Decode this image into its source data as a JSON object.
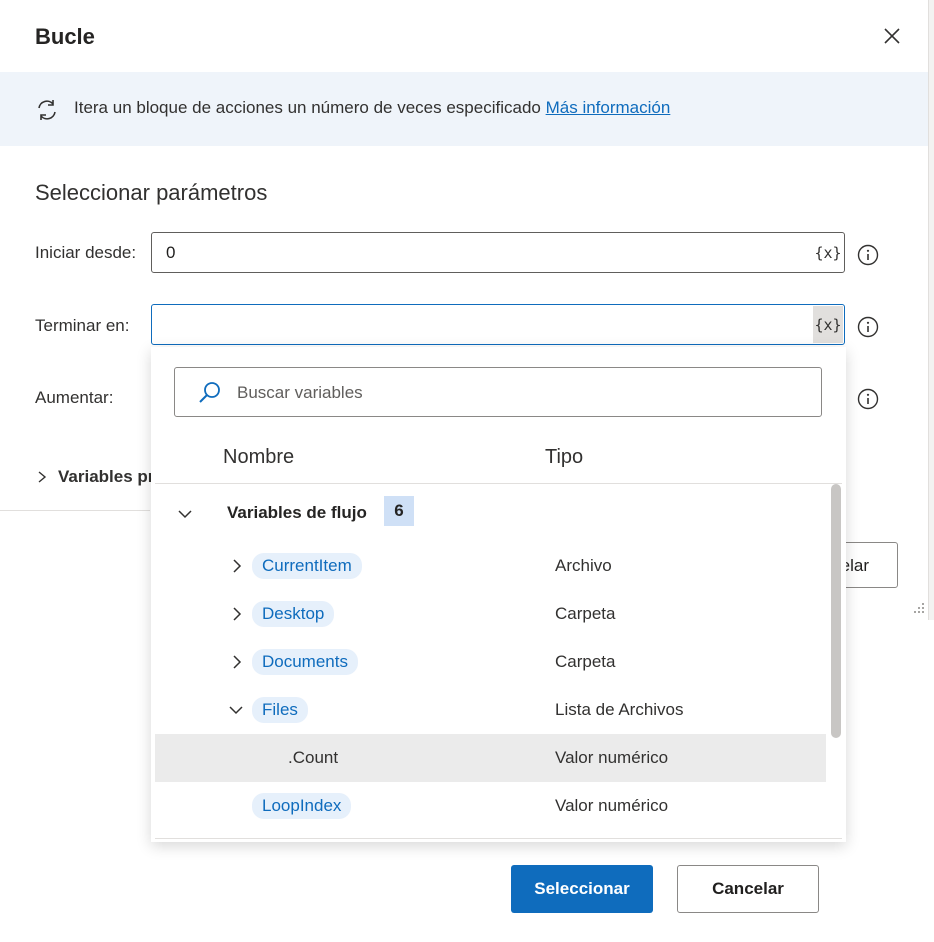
{
  "dialog": {
    "title": "Bucle",
    "banner_text": "Itera un bloque de acciones un número de veces especificado",
    "banner_link": "Más información",
    "section_title": "Seleccionar parámetros",
    "fields": [
      {
        "label": "Iniciar desde:",
        "value": "0"
      },
      {
        "label": "Terminar en:",
        "value": ""
      },
      {
        "label": "Aumentar:",
        "value": ""
      }
    ],
    "var_button_label": "{x}",
    "collapse_label": "Variables pr",
    "bg_cancel_partial": "elar"
  },
  "picker": {
    "search_placeholder": "Buscar variables",
    "col_name": "Nombre",
    "col_type": "Tipo",
    "group": {
      "label": "Variables de flujo",
      "count": "6"
    },
    "rows": [
      {
        "name": "CurrentItem",
        "type": "Archivo"
      },
      {
        "name": "Desktop",
        "type": "Carpeta"
      },
      {
        "name": "Documents",
        "type": "Carpeta"
      },
      {
        "name": "Files",
        "type": "Lista de Archivos"
      },
      {
        "name": ".Count",
        "type": "Valor numérico"
      },
      {
        "name": "LoopIndex",
        "type": "Valor numérico"
      }
    ],
    "select_label": "Seleccionar",
    "cancel_label": "Cancelar"
  },
  "colors": {
    "accent": "#0f6cbd",
    "banner_bg": "#eff4fa",
    "chip_bg": "#e6f0fb",
    "selected_row": "#ebebeb"
  }
}
